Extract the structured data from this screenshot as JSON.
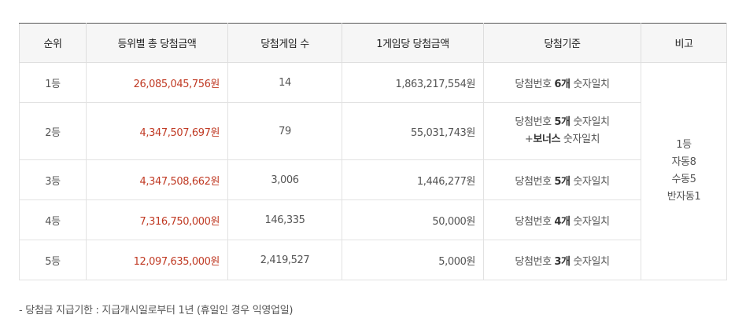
{
  "headers": [
    "순위",
    "등위별 총 당첨금액",
    "당첨게임 수",
    "1게임당 당첨금액",
    "당첨기준",
    "비고"
  ],
  "rows": [
    {
      "rank": "1등",
      "total": "26,085,045,756원",
      "games": "14",
      "per_game": "1,863,217,554원",
      "crit_pre": "당첨번호 ",
      "crit_bold": "6개",
      "crit_post": " 숫자일치",
      "crit_line2_pre": "",
      "crit_line2_bold": "",
      "crit_line2_post": ""
    },
    {
      "rank": "2등",
      "total": "4,347,507,697원",
      "games": "79",
      "per_game": "55,031,743원",
      "crit_pre": "당첨번호 ",
      "crit_bold": "5개",
      "crit_post": " 숫자일치",
      "crit_line2_pre": "+",
      "crit_line2_bold": "보너스",
      "crit_line2_post": " 숫자일치"
    },
    {
      "rank": "3등",
      "total": "4,347,508,662원",
      "games": "3,006",
      "per_game": "1,446,277원",
      "crit_pre": "당첨번호 ",
      "crit_bold": "5개",
      "crit_post": " 숫자일치"
    },
    {
      "rank": "4등",
      "total": "7,316,750,000원",
      "games": "146,335",
      "per_game": "50,000원",
      "crit_pre": "당첨번호 ",
      "crit_bold": "4개",
      "crit_post": " 숫자일치"
    },
    {
      "rank": "5등",
      "total": "12,097,635,000원",
      "games": "2,419,527",
      "per_game": "5,000원",
      "crit_pre": "당첨번호 ",
      "crit_bold": "3개",
      "crit_post": " 숫자일치"
    }
  ],
  "note": [
    "1등",
    "자동8",
    "수동5",
    "반자동1"
  ],
  "footnote": "-  당첨금 지급기한 : 지급개시일로부터 1년 (휴일인 경우 익영업일)",
  "colors": {
    "amount": "#c03a24",
    "header_bg": "#f6f6f6",
    "border": "#e2e2e2"
  }
}
